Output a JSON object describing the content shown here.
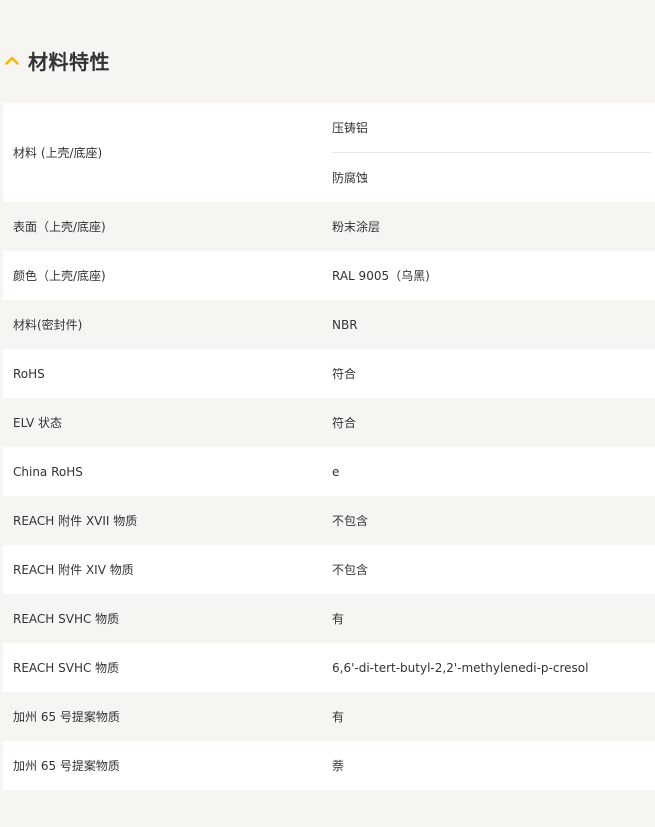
{
  "section": {
    "title": "材料特性",
    "icon": "chevron-up-icon",
    "accent_color": "#f5b800"
  },
  "specs": [
    {
      "label": "材料 (上壳/底座)",
      "values": [
        "压铸铝",
        "防腐蚀"
      ]
    },
    {
      "label": "表面（上壳/底座)",
      "value": "粉末涂层"
    },
    {
      "label": "颜色（上壳/底座)",
      "value": "RAL 9005（乌黑)"
    },
    {
      "label": "材料(密封件)",
      "value": "NBR"
    },
    {
      "label": "RoHS",
      "value": "符合"
    },
    {
      "label": "ELV 状态",
      "value": "符合"
    },
    {
      "label": "China RoHS",
      "value": "e"
    },
    {
      "label": "REACH 附件 XVII 物质",
      "value": "不包含"
    },
    {
      "label": "REACH 附件 XIV 物质",
      "value": "不包含"
    },
    {
      "label": "REACH SVHC 物质",
      "value": "有"
    },
    {
      "label": "REACH SVHC 物质",
      "value": "6,6'-di-tert-butyl-2,2'-methylenedi-p-cresol"
    },
    {
      "label": "加州 65 号提案物质",
      "value": "有"
    },
    {
      "label": "加州 65 号提案物质",
      "value": "萘"
    }
  ]
}
